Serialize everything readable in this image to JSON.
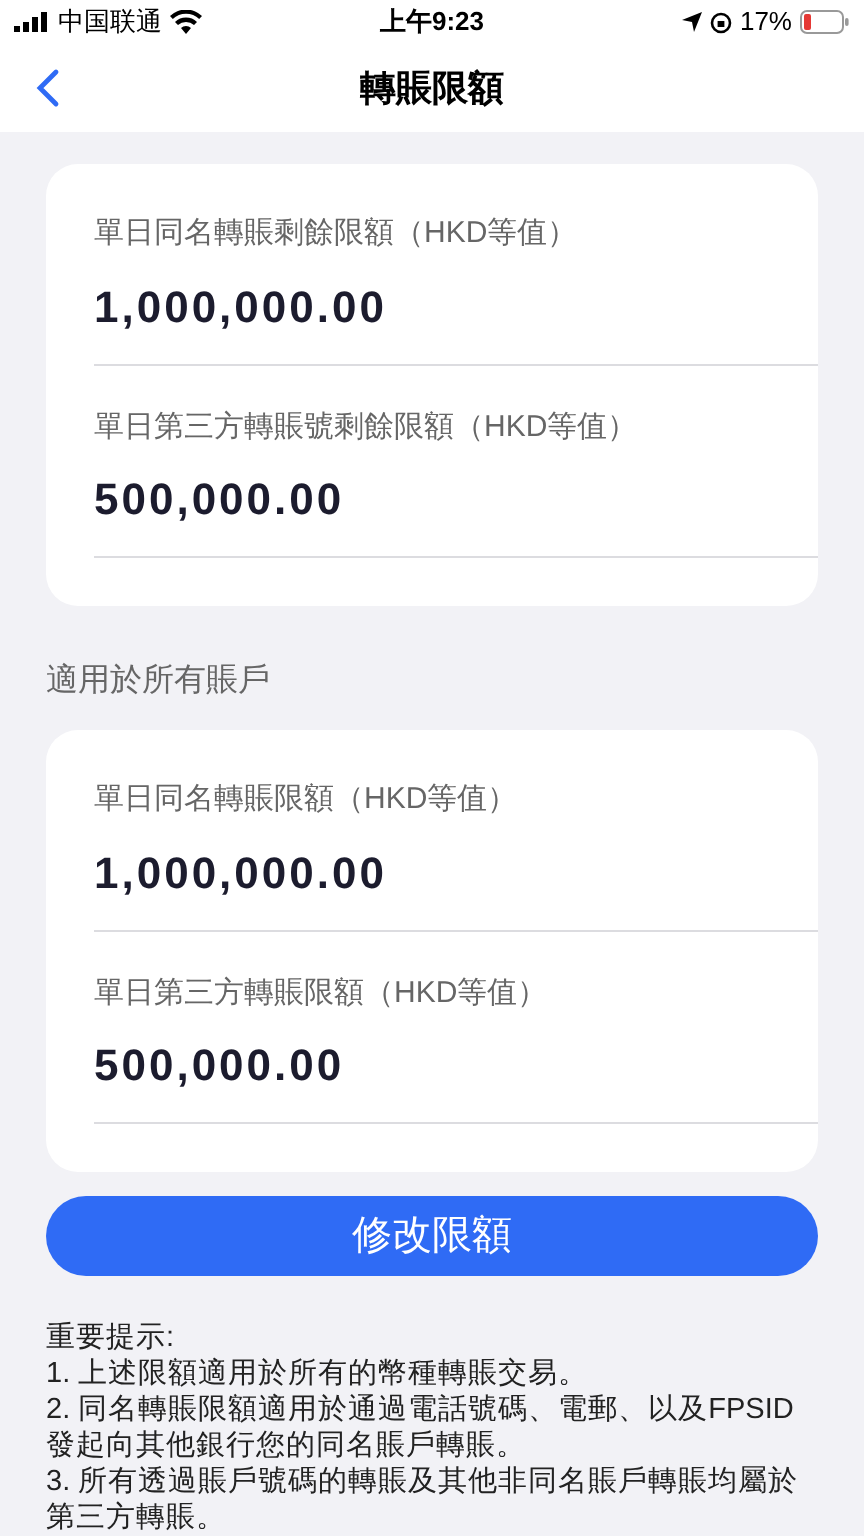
{
  "status_bar": {
    "carrier": "中国联通",
    "time": "上午9:23",
    "battery": "17%"
  },
  "nav": {
    "title": "轉賬限額"
  },
  "remaining_card": {
    "items": [
      {
        "label": "單日同名轉賬剩餘限額（HKD等值）",
        "amount": "1,000,000.00"
      },
      {
        "label": "單日第三方轉賬號剩餘限額（HKD等值）",
        "amount": "500,000.00"
      }
    ]
  },
  "section_title": "適用於所有賬戶",
  "limits_card": {
    "items": [
      {
        "label": "單日同名轉賬限額（HKD等值）",
        "amount": "1,000,000.00"
      },
      {
        "label": "單日第三方轉賬限額（HKD等值）",
        "amount": "500,000.00"
      }
    ]
  },
  "modify_button": "修改限額",
  "notes": {
    "title": "重要提示:",
    "items": [
      "1. 上述限額適用於所有的幣種轉賬交易。",
      "2. 同名轉賬限額適用於通過電話號碼、電郵、以及FPSID發起向其他銀行您的同名賬戶轉賬。",
      "3. 所有透過賬戶號碼的轉賬及其他非同名賬戶轉賬均屬於第三方轉賬。"
    ]
  }
}
